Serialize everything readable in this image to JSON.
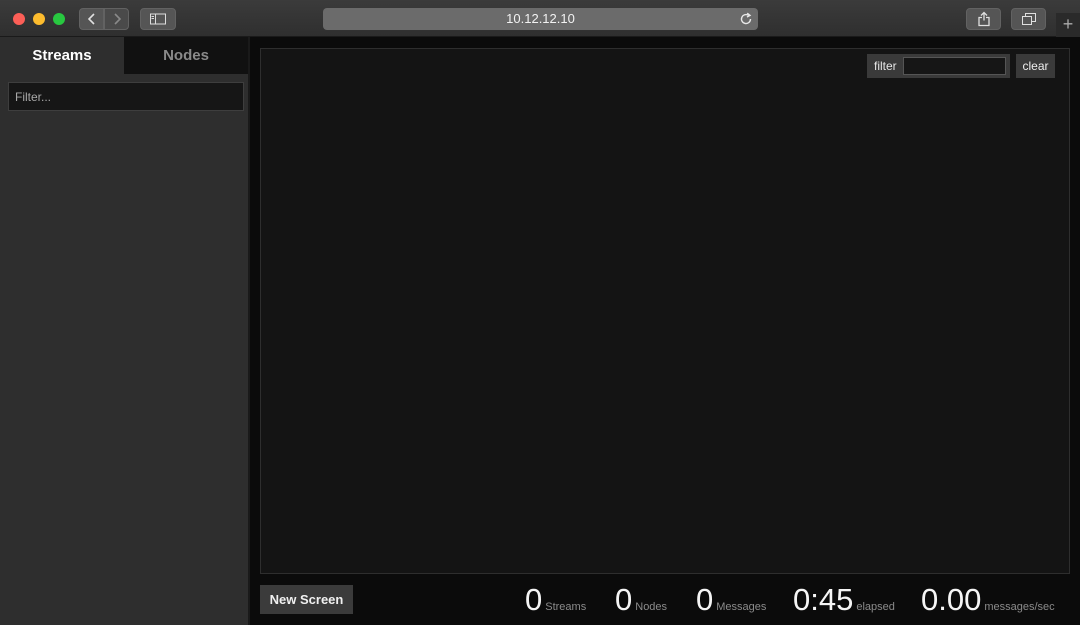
{
  "browser": {
    "url": "10.12.12.10",
    "new_tab_label": "+"
  },
  "sidebar": {
    "tabs": [
      {
        "label": "Streams",
        "active": true
      },
      {
        "label": "Nodes",
        "active": false
      }
    ],
    "filter_placeholder": "Filter..."
  },
  "screen": {
    "filter_label": "filter",
    "filter_value": "",
    "clear_label": "clear"
  },
  "footer": {
    "new_screen_label": "New Screen",
    "stats": {
      "streams": {
        "value": "0",
        "label": "Streams"
      },
      "nodes": {
        "value": "0",
        "label": "Nodes"
      },
      "messages": {
        "value": "0",
        "label": "Messages"
      },
      "elapsed": {
        "value": "0:45",
        "label": "elapsed"
      },
      "rate": {
        "value": "0.00",
        "label": "messages/sec"
      }
    }
  },
  "colors": {
    "background": "#0b0b0b",
    "sidebar": "#2e2e2e",
    "screen": "#141414"
  }
}
